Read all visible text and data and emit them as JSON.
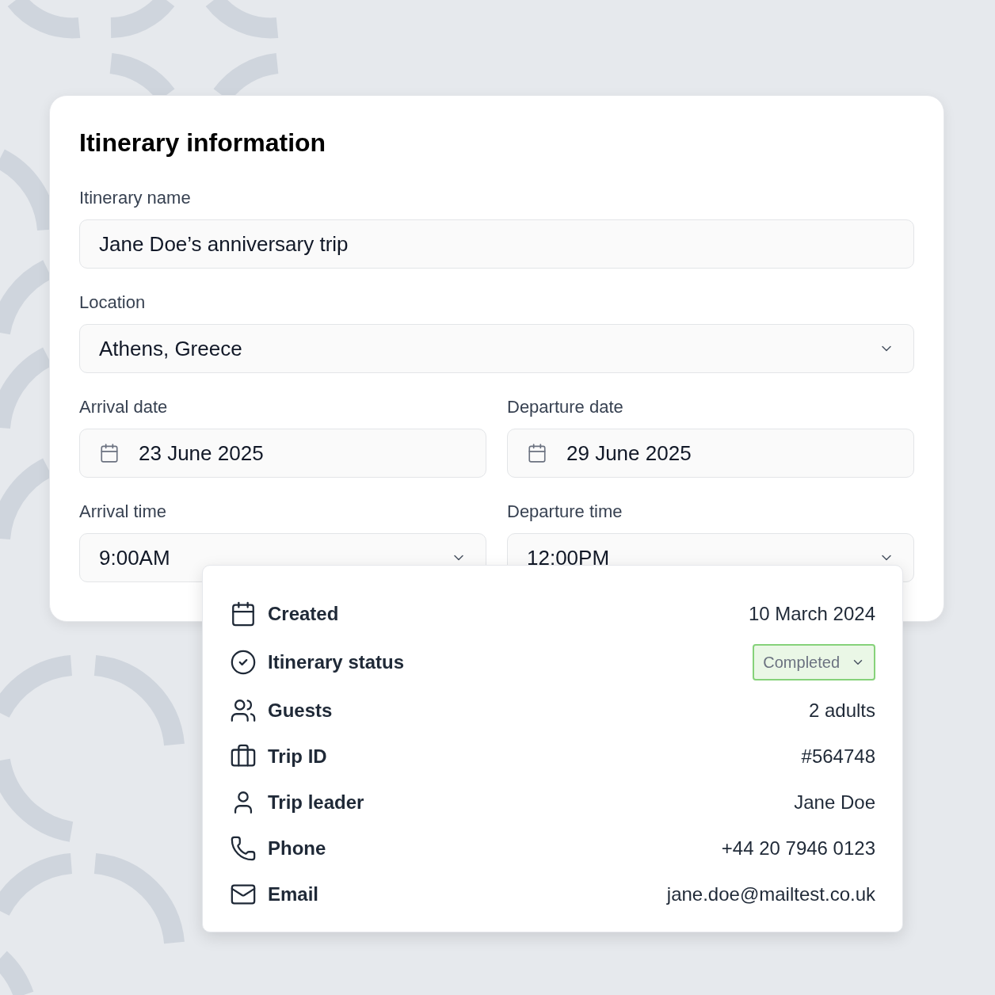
{
  "form": {
    "title": "Itinerary information",
    "fields": [
      {
        "label": "Itinerary name",
        "kind": "text",
        "value": "Jane Doe’s anniversary trip"
      },
      {
        "label": "Location",
        "kind": "select",
        "value": "Athens, Greece"
      },
      {
        "label": "Arrival date",
        "kind": "date",
        "value": "23 June 2025"
      },
      {
        "label": "Departure date",
        "kind": "date",
        "value": "29 June 2025"
      },
      {
        "label": "Arrival time",
        "kind": "select",
        "value": "9:00AM"
      },
      {
        "label": "Departure time",
        "kind": "select",
        "value": "12:00PM"
      }
    ]
  },
  "details": [
    {
      "label": "Created",
      "kind": "text",
      "value": "10 March 2024"
    },
    {
      "label": "Itinerary status",
      "kind": "status",
      "value": "Completed"
    },
    {
      "label": "Guests",
      "kind": "text",
      "value": "2 adults"
    },
    {
      "label": "Trip ID",
      "kind": "text",
      "value": "#564748"
    },
    {
      "label": "Trip leader",
      "kind": "text",
      "value": "Jane Doe"
    },
    {
      "label": "Phone",
      "kind": "text",
      "value": "+44 20 7946 0123"
    },
    {
      "label": "Email",
      "kind": "text",
      "value": "jane.doe@mailtest.co.uk"
    }
  ]
}
